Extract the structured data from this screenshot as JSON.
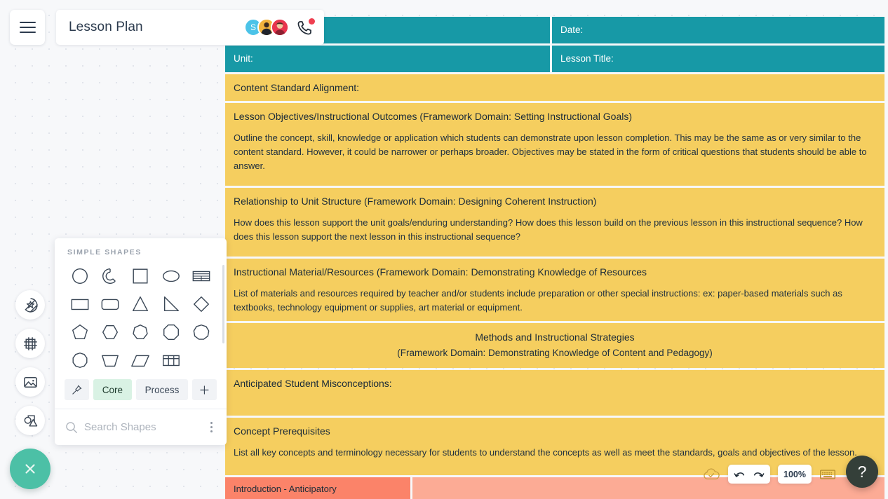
{
  "app": {
    "document_title": "Lesson Plan",
    "menu_icon": "hamburger-menu-icon"
  },
  "collaborators": [
    {
      "initial": "S",
      "color": "#4bc3e8",
      "type": "initial-avatar"
    },
    {
      "initial": "",
      "color": "#f2b33d",
      "type": "photo-avatar"
    },
    {
      "initial": "",
      "color": "#e8344e",
      "type": "photo-avatar"
    }
  ],
  "call_button": {
    "icon": "phone-icon",
    "notification_dot_color": "#ef3f50"
  },
  "sidebar": {
    "items": [
      {
        "icon": "sticker-star-icon",
        "name": "stickers"
      },
      {
        "icon": "frame-icon",
        "name": "frames"
      },
      {
        "icon": "image-icon",
        "name": "images"
      },
      {
        "icon": "shapes-icon",
        "name": "shapes"
      }
    ],
    "close_button": {
      "icon": "close-x-icon",
      "color": "#4cc0a6"
    }
  },
  "shapes_panel": {
    "header": "SIMPLE SHAPES",
    "shapes": [
      {
        "name": "circle-shape"
      },
      {
        "name": "arc-shape"
      },
      {
        "name": "square-shape"
      },
      {
        "name": "ellipse-shape"
      },
      {
        "name": "striped-rows-shape"
      },
      {
        "name": "rectangle-shape"
      },
      {
        "name": "rounded-rectangle-shape"
      },
      {
        "name": "triangle-shape"
      },
      {
        "name": "right-triangle-shape"
      },
      {
        "name": "diamond-shape"
      },
      {
        "name": "pentagon-shape"
      },
      {
        "name": "hexagon-shape"
      },
      {
        "name": "heptagon-shape"
      },
      {
        "name": "octagon-shape"
      },
      {
        "name": "nonagon-shape"
      },
      {
        "name": "decagon-shape"
      },
      {
        "name": "trapezoid-shape"
      },
      {
        "name": "parallelogram-shape"
      },
      {
        "name": "table-grid-shape"
      }
    ],
    "tags": [
      {
        "label": "",
        "icon": "pin-icon",
        "active": false
      },
      {
        "label": "Core",
        "icon": "",
        "active": true
      },
      {
        "label": "Process",
        "icon": "",
        "active": false
      },
      {
        "label": "",
        "icon": "plus-icon",
        "active": false
      }
    ],
    "search": {
      "placeholder": "Search Shapes",
      "icon": "search-icon",
      "overflow_icon": "kebab-menu-icon"
    }
  },
  "document": {
    "header_rows": [
      {
        "left_label": "",
        "right_label": "Date:"
      },
      {
        "left_label": "Unit:",
        "right_label": "Lesson Title:"
      }
    ],
    "sections": [
      {
        "title": "Content Standard Alignment:",
        "body": "",
        "centered": false
      },
      {
        "title": "Lesson Objectives/Instructional Outcomes (Framework Domain: Setting Instructional Goals)",
        "body": "Outline the concept, skill, knowledge or application which students can demonstrate upon lesson completion. This may be the same as or very similar to the content standard. However, it could be narrower or perhaps broader. Objectives may be stated in the form of critical questions that students should be able to answer.",
        "centered": false
      },
      {
        "title": "Relationship to Unit Structure (Framework Domain: Designing Coherent Instruction)",
        "body": "How does this lesson support the unit goals/enduring understanding? How does this lesson build on the previous lesson in this instructional sequence? How does this lesson support the next lesson in this instructional sequence?",
        "centered": false
      },
      {
        "title": "Instructional Material/Resources (Framework Domain: Demonstrating Knowledge of Resources",
        "body": "List of materials and resources required by teacher and/or students include preparation or other special instructions: ex: paper-based materials such as textbooks, technology equipment or supplies, art material or equipment.",
        "centered": false
      },
      {
        "title": "Methods and Instructional Strategies",
        "subtitle": "(Framework Domain: Demonstrating Knowledge of Content and Pedagogy)",
        "body": "",
        "centered": true
      },
      {
        "title": "Anticipated Student Misconceptions:",
        "body": "",
        "centered": false
      },
      {
        "title": "Concept Prerequisites",
        "body": "List all key concepts and terminology necessary for students to understand the concepts as well as meet the standards, goals and objectives of the lesson.",
        "centered": false
      }
    ],
    "bottom_row": {
      "left_label": "Introduction - Anticipatory",
      "left_color": "#fb8369",
      "right_color": "#fcab95"
    },
    "colors": {
      "header_teal": "#1799a6",
      "section_yellow": "#f5ce5f"
    }
  },
  "bottom_toolbar": {
    "save_status_icon": "cloud-check-icon",
    "undo_icon": "undo-icon",
    "redo_icon": "redo-icon",
    "zoom_level": "100%",
    "keyboard_icon": "keyboard-icon",
    "help_label": "?"
  }
}
